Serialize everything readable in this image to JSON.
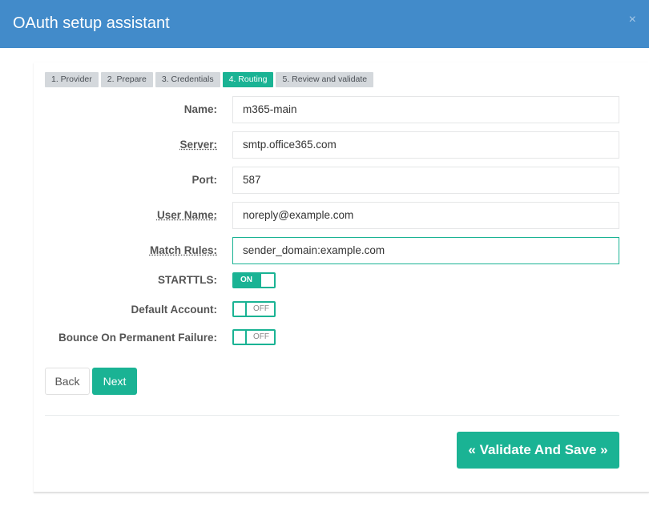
{
  "modal": {
    "title": "OAuth setup assistant",
    "close": "×"
  },
  "steps": [
    {
      "label": "1. Provider",
      "active": false
    },
    {
      "label": "2. Prepare",
      "active": false
    },
    {
      "label": "3. Credentials",
      "active": false
    },
    {
      "label": "4. Routing",
      "active": true
    },
    {
      "label": "5. Review and validate",
      "active": false
    }
  ],
  "form": {
    "name": {
      "label": "Name:",
      "value": "m365-main"
    },
    "server": {
      "label": "Server:",
      "value": "smtp.office365.com"
    },
    "port": {
      "label": "Port:",
      "value": "587"
    },
    "username": {
      "label": "User Name:",
      "value": "noreply@example.com"
    },
    "match_rules": {
      "label": "Match Rules:",
      "value": "sender_domain:example.com"
    },
    "starttls": {
      "label": "STARTTLS:",
      "state": "ON"
    },
    "default_account": {
      "label": "Default Account:",
      "state": "OFF"
    },
    "bounce": {
      "label": "Bounce On Permanent Failure:",
      "state": "OFF"
    }
  },
  "buttons": {
    "back": "Back",
    "next": "Next",
    "validate": "« Validate And Save »"
  },
  "colors": {
    "header": "#428bca",
    "accent": "#1ab394"
  }
}
